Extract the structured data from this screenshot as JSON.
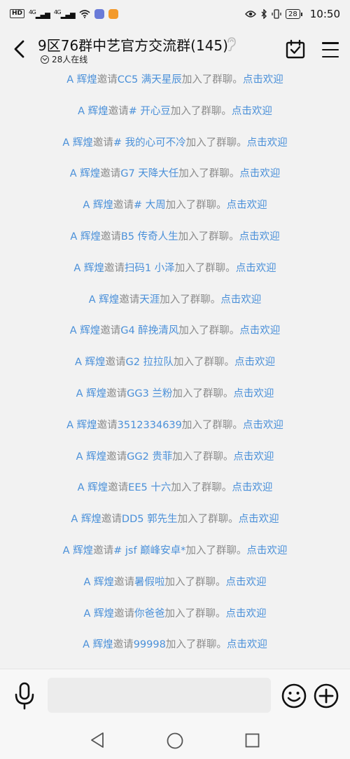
{
  "status_bar": {
    "hd": "HD",
    "net1": "4G",
    "net2": "4G",
    "battery": "28",
    "time": "10:50"
  },
  "header": {
    "title": "9区76群中艺官方交流群(145)",
    "online": "28人在线"
  },
  "messages": [
    {
      "name": "A 辉煌",
      "text1": "邀请",
      "invitee": "CC5 满天星辰",
      "text2": "加入了群聊。",
      "action": "点击欢迎"
    },
    {
      "name": "A 辉煌",
      "text1": "邀请",
      "invitee": "# 开心豆",
      "text2": "加入了群聊。",
      "action": "点击欢迎"
    },
    {
      "name": "A 辉煌",
      "text1": "邀请",
      "invitee": "# 我的心可不冷",
      "text2": "加入了群聊。",
      "action": "点击欢迎"
    },
    {
      "name": "A 辉煌",
      "text1": "邀请",
      "invitee": "G7 天降大任",
      "text2": "加入了群聊。",
      "action": "点击欢迎"
    },
    {
      "name": "A 辉煌",
      "text1": "邀请",
      "invitee": "# 大周",
      "text2": "加入了群聊。",
      "action": "点击欢迎"
    },
    {
      "name": "A 辉煌",
      "text1": "邀请",
      "invitee": "B5 传奇人生",
      "text2": "加入了群聊。",
      "action": "点击欢迎"
    },
    {
      "name": "A 辉煌",
      "text1": "邀请",
      "invitee": "扫码1 小泽",
      "text2": "加入了群聊。",
      "action": "点击欢迎"
    },
    {
      "name": "A 辉煌",
      "text1": "邀请",
      "invitee": "天涯",
      "text2": "加入了群聊。",
      "action": "点击欢迎"
    },
    {
      "name": "A 辉煌",
      "text1": "邀请",
      "invitee": "G4 醉挽清风",
      "text2": "加入了群聊。",
      "action": "点击欢迎"
    },
    {
      "name": "A 辉煌",
      "text1": "邀请",
      "invitee": "G2 拉拉队",
      "text2": "加入了群聊。",
      "action": "点击欢迎"
    },
    {
      "name": "A 辉煌",
      "text1": "邀请",
      "invitee": "GG3 兰粉",
      "text2": "加入了群聊。",
      "action": "点击欢迎"
    },
    {
      "name": "A 辉煌",
      "text1": "邀请",
      "invitee": "3512334639",
      "text2": "加入了群聊。",
      "action": "点击欢迎"
    },
    {
      "name": "A 辉煌",
      "text1": "邀请",
      "invitee": "GG2 贵菲",
      "text2": "加入了群聊。",
      "action": "点击欢迎"
    },
    {
      "name": "A 辉煌",
      "text1": "邀请",
      "invitee": "EE5 十六",
      "text2": "加入了群聊。",
      "action": "点击欢迎"
    },
    {
      "name": "A 辉煌",
      "text1": "邀请",
      "invitee": "DD5 郭先生",
      "text2": "加入了群聊。",
      "action": "点击欢迎"
    },
    {
      "name": "A 辉煌",
      "text1": "邀请",
      "invitee": "# jsf 巅峰安卓*",
      "text2": "加入了群聊。",
      "action": "点击欢迎"
    },
    {
      "name": "A 辉煌",
      "text1": "邀请",
      "invitee": "暑假啦",
      "text2": "加入了群聊。",
      "action": "点击欢迎"
    },
    {
      "name": "A 辉煌",
      "text1": "邀请",
      "invitee": "你爸爸",
      "text2": "加入了群聊。",
      "action": "点击欢迎"
    },
    {
      "name": "A 辉煌",
      "text1": "邀请",
      "invitee": "99998",
      "text2": "加入了群聊。",
      "action": "点击欢迎"
    }
  ],
  "input": {
    "value": "",
    "placeholder": ""
  },
  "colors": {
    "link": "#4a90d9",
    "system_text": "#8a8a8a",
    "background": "#f2f2f2"
  }
}
